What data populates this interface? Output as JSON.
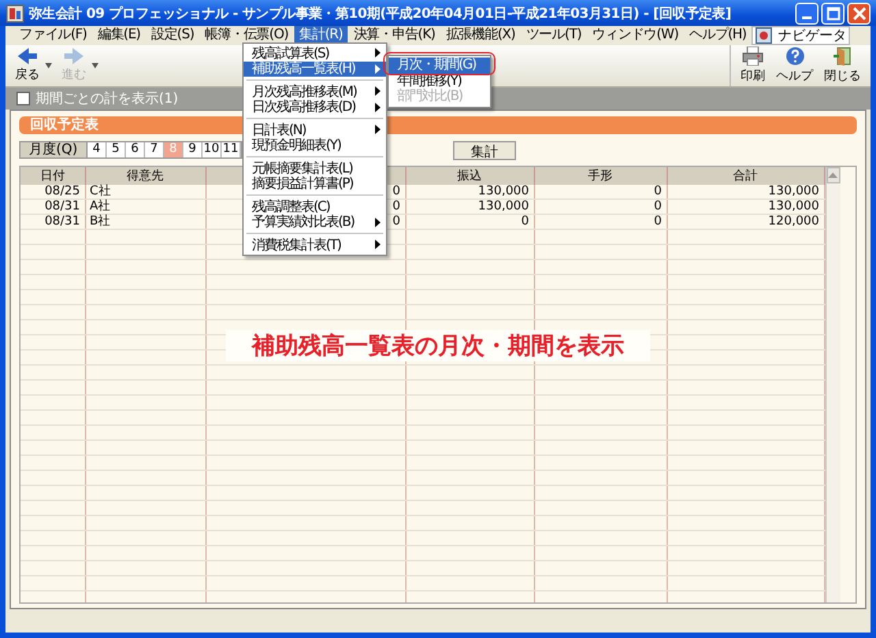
{
  "window": {
    "title": "弥生会計 09 プロフェッショナル - サンプル事業・第10期(平成20年04月01日-平成21年03月31日) - [回収予定表]"
  },
  "menu_bar": {
    "items": [
      {
        "label": "ファイル(F)",
        "selected": false
      },
      {
        "label": "編集(E)",
        "selected": false
      },
      {
        "label": "設定(S)",
        "selected": false
      },
      {
        "label": "帳簿・伝票(O)",
        "selected": false
      },
      {
        "label": "集計(R)",
        "selected": true
      },
      {
        "label": "決算・申告(K)",
        "selected": false
      },
      {
        "label": "拡張機能(X)",
        "selected": false
      },
      {
        "label": "ツール(T)",
        "selected": false
      },
      {
        "label": "ウィンドウ(W)",
        "selected": false
      },
      {
        "label": "ヘルプ(H)",
        "selected": false
      }
    ],
    "navigator": "ナビゲータ"
  },
  "toolbar": {
    "left": [
      {
        "label": "戻る",
        "disabled": false
      },
      {
        "label": "進む",
        "disabled": true
      }
    ],
    "right": [
      {
        "kind": "print",
        "label": "印刷"
      },
      {
        "kind": "help",
        "label": "ヘルプ"
      },
      {
        "kind": "close",
        "label": "閉じる"
      }
    ]
  },
  "options": {
    "label": "期間ごとの計を表示(1)",
    "checked": false
  },
  "panel": {
    "title": "回収予定表"
  },
  "months": {
    "label": "月度(Q)",
    "items": [
      {
        "label": "4",
        "selected": false
      },
      {
        "label": "5",
        "selected": false
      },
      {
        "label": "6",
        "selected": false
      },
      {
        "label": "7",
        "selected": false
      },
      {
        "label": "8",
        "selected": true
      },
      {
        "label": "9",
        "selected": false
      },
      {
        "label": "10",
        "selected": false
      },
      {
        "label": "11",
        "selected": false
      }
    ],
    "button": "集計"
  },
  "table": {
    "columns": [
      {
        "label": "日付"
      },
      {
        "label": "得意先"
      },
      {},
      {
        "label": "振込"
      },
      {
        "label": "手形"
      },
      {
        "label": "合計"
      }
    ],
    "rows": [
      {
        "date": "08/25",
        "customer": "C社",
        "column_3": "0",
        "transfer": "130,000",
        "bill": "0",
        "total": "130,000"
      },
      {
        "date": "08/31",
        "customer": "A社",
        "column_3": "0",
        "transfer": "130,000",
        "bill": "0",
        "total": "130,000"
      },
      {
        "date": "08/31",
        "customer": "B社",
        "column_3": "0",
        "transfer": "0",
        "bill": "0",
        "total": "120,000"
      }
    ]
  },
  "dropdown": {
    "items": [
      {
        "kind": "item",
        "label": "残高試算表(S)",
        "submenu": true,
        "selected": false
      },
      {
        "kind": "item",
        "label": "補助残高一覧表(H)",
        "submenu": true,
        "selected": true
      },
      {
        "kind": "separator"
      },
      {
        "kind": "item",
        "label": "月次残高推移表(M)",
        "submenu": true,
        "selected": false
      },
      {
        "kind": "item",
        "label": "日次残高推移表(D)",
        "submenu": true,
        "selected": false
      },
      {
        "kind": "separator"
      },
      {
        "kind": "item",
        "label": "日計表(N)",
        "submenu": true,
        "selected": false
      },
      {
        "kind": "item",
        "label": "現預金明細表(Y)",
        "submenu": false,
        "selected": false
      },
      {
        "kind": "separator"
      },
      {
        "kind": "item",
        "label": "元帳摘要集計表(L)",
        "submenu": false,
        "selected": false
      },
      {
        "kind": "item",
        "label": "摘要損益計算書(P)",
        "submenu": false,
        "selected": false
      },
      {
        "kind": "separator"
      },
      {
        "kind": "item",
        "label": "残高調整表(C)",
        "submenu": false,
        "selected": false
      },
      {
        "kind": "item",
        "label": "予算実績対比表(B)",
        "submenu": true,
        "selected": false
      },
      {
        "kind": "separator"
      },
      {
        "kind": "item",
        "label": "消費税集計表(T)",
        "submenu": true,
        "selected": false
      }
    ]
  },
  "submenu": {
    "items": [
      {
        "label": "月次・期間(G)",
        "selected": true,
        "disabled": false
      },
      {
        "label": "年間推移(Y)",
        "selected": false,
        "disabled": false
      },
      {
        "label": "部門対比(B)",
        "selected": false,
        "disabled": true
      }
    ]
  },
  "caption": "補助残高一覧表の月次・期間を表示"
}
